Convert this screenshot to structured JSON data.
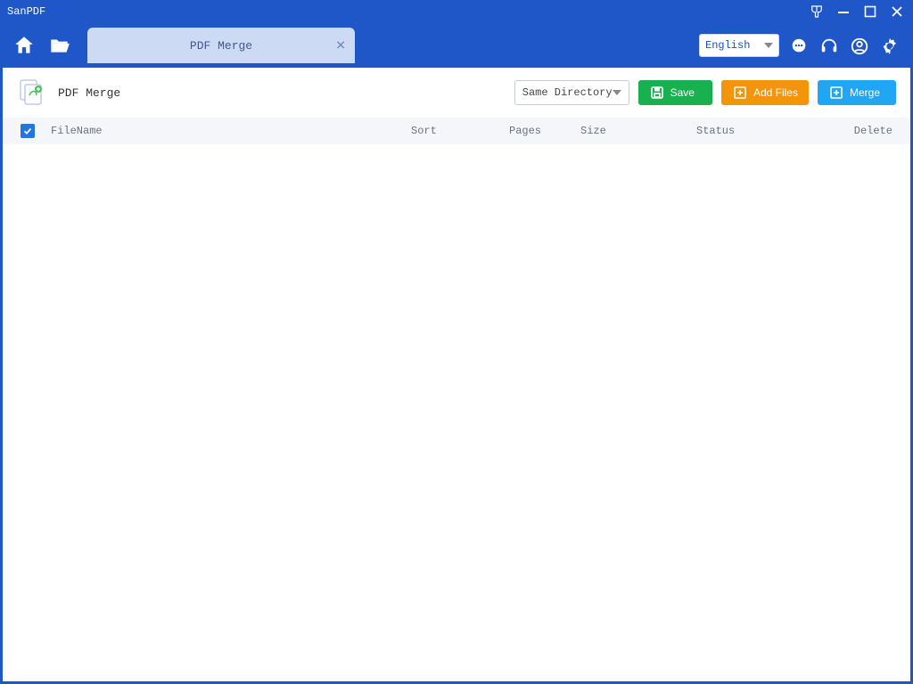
{
  "app": {
    "title": "SanPDF"
  },
  "header": {
    "tab_label": "PDF Merge",
    "language_selected": "English"
  },
  "toolbar": {
    "page_title": "PDF Merge",
    "directory_mode": "Same Directory",
    "save_label": "Save",
    "add_files_label": "Add Files",
    "merge_label": "Merge"
  },
  "table": {
    "columns": {
      "filename": "FileName",
      "sort": "Sort",
      "pages": "Pages",
      "size": "Size",
      "status": "Status",
      "delete": "Delete"
    },
    "rows": []
  }
}
